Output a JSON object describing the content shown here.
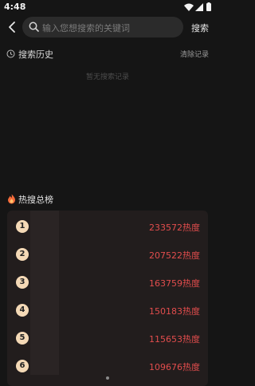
{
  "status": {
    "time": "4:48"
  },
  "search": {
    "placeholder": "输入您想搜索的关键词",
    "button_label": "搜索"
  },
  "history": {
    "title": "搜索历史",
    "clear_label": "清除记录",
    "empty_text": "暂无搜索记录"
  },
  "hot": {
    "title": "热搜总榜",
    "items": [
      {
        "rank": "1",
        "heat": "233572热度"
      },
      {
        "rank": "2",
        "heat": "207522热度"
      },
      {
        "rank": "3",
        "heat": "163759热度"
      },
      {
        "rank": "4",
        "heat": "150183热度"
      },
      {
        "rank": "5",
        "heat": "115653热度"
      },
      {
        "rank": "6",
        "heat": "109676热度"
      }
    ]
  },
  "colors": {
    "heat": "#e24d4d",
    "rank_badge": "#f4d9b6",
    "background": "#151515"
  },
  "icons": [
    "wifi-icon",
    "signal-icon",
    "battery-icon",
    "back-arrow-icon",
    "search-icon",
    "clock-icon",
    "fire-icon"
  ]
}
